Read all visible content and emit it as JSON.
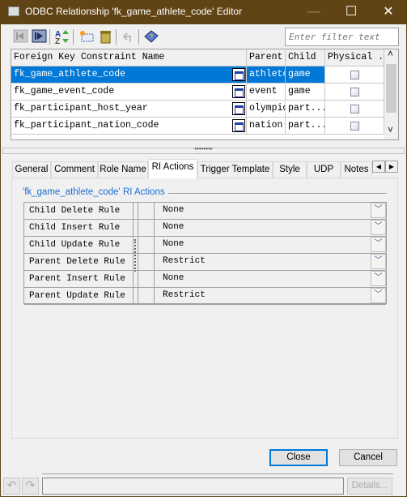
{
  "window": {
    "title": "ODBC Relationship 'fk_game_athlete_code' Editor",
    "minimize": "—",
    "maximize": "☐",
    "close": "✕"
  },
  "toolbar": {
    "filter_placeholder": "Enter filter text",
    "icons": [
      "first-record-icon",
      "next-record-icon",
      "sort-az-icon",
      "new-icon",
      "delete-trash-icon",
      "undo-icon",
      "help-book-icon"
    ]
  },
  "grid": {
    "columns": [
      "Foreign Key Constraint Name",
      "Parent",
      "Child",
      "Physical ..."
    ],
    "rows": [
      {
        "name": "fk_game_athlete_code",
        "parent": "athlete",
        "child": "game",
        "physical": false,
        "selected": true
      },
      {
        "name": "fk_game_event_code",
        "parent": "event",
        "child": "game",
        "physical": false
      },
      {
        "name": "fk_participant_host_year",
        "parent": "olympic",
        "child": "part...",
        "physical": false
      },
      {
        "name": "fk_participant_nation_code",
        "parent": "nation",
        "child": "part...",
        "physical": false
      }
    ],
    "scroll_up": "˄",
    "scroll_down": "˅"
  },
  "splitter": "••••••••",
  "tabs": [
    {
      "label": "General"
    },
    {
      "label": "Comment"
    },
    {
      "label": "Role Name"
    },
    {
      "label": "RI Actions",
      "active": true
    },
    {
      "label": "Trigger Template"
    },
    {
      "label": "Style"
    },
    {
      "label": "UDP"
    },
    {
      "label": "Notes"
    }
  ],
  "tab_scroll": {
    "left": "◀",
    "right": "▶"
  },
  "ri": {
    "group_title": "'fk_game_athlete_code' RI Actions",
    "rules": [
      {
        "label": "Child Delete Rule",
        "value": "None"
      },
      {
        "label": "Child Insert Rule",
        "value": "None"
      },
      {
        "label": "Child Update Rule",
        "value": "None"
      },
      {
        "label": "Parent Delete Rule",
        "value": "Restrict"
      },
      {
        "label": "Parent Insert Rule",
        "value": "None"
      },
      {
        "label": "Parent Update Rule",
        "value": "Restrict"
      }
    ],
    "dropdown_glyph": "﹀"
  },
  "buttons": {
    "close": "Close",
    "cancel": "Cancel",
    "details": "Details..."
  },
  "status": {
    "message": "",
    "undo": "↶",
    "redo": "↷"
  },
  "colors": {
    "titlebar": "#614416",
    "selection": "#0078d7",
    "group_title": "#1a6fd0"
  }
}
